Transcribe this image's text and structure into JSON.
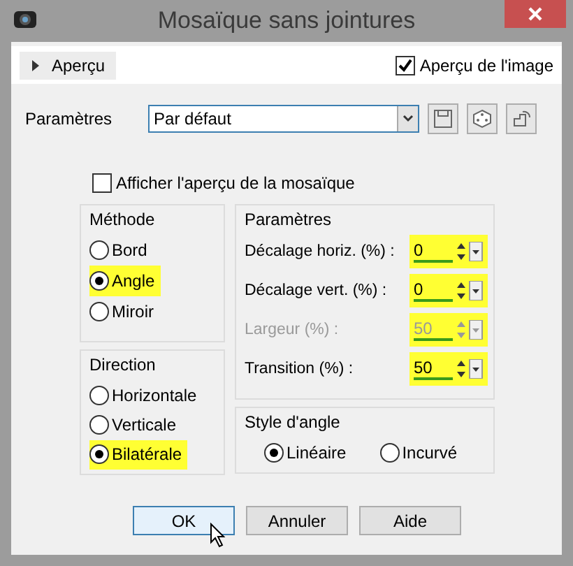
{
  "window": {
    "title": "Mosaïque sans jointures"
  },
  "preview_toggle": {
    "label": "Aperçu",
    "expanded": false
  },
  "image_preview": {
    "label": "Aperçu de l'image",
    "checked": true
  },
  "presets": {
    "label": "Paramètres",
    "value": "Par défaut"
  },
  "show_tile_preview": {
    "label": "Afficher l'aperçu de la mosaïque",
    "checked": false
  },
  "method": {
    "title": "Méthode",
    "options": [
      {
        "label": "Bord",
        "selected": false,
        "highlighted": false
      },
      {
        "label": "Angle",
        "selected": true,
        "highlighted": true
      },
      {
        "label": "Miroir",
        "selected": false,
        "highlighted": false
      }
    ]
  },
  "direction": {
    "title": "Direction",
    "options": [
      {
        "label": "Horizontale",
        "selected": false,
        "highlighted": false
      },
      {
        "label": "Verticale",
        "selected": false,
        "highlighted": false
      },
      {
        "label": "Bilatérale",
        "selected": true,
        "highlighted": true
      }
    ]
  },
  "parameters": {
    "title": "Paramètres",
    "fields": [
      {
        "label": "Décalage horiz. (%) :",
        "value": "0",
        "disabled": false,
        "highlighted": true
      },
      {
        "label": "Décalage vert. (%) :",
        "value": "0",
        "disabled": false,
        "highlighted": true
      },
      {
        "label": "Largeur (%) :",
        "value": "50",
        "disabled": true,
        "highlighted": true
      },
      {
        "label": "Transition (%) :",
        "value": "50",
        "disabled": false,
        "highlighted": true
      }
    ]
  },
  "angle_style": {
    "title": "Style d'angle",
    "options": [
      {
        "label": "Linéaire",
        "selected": true
      },
      {
        "label": "Incurvé",
        "selected": false
      }
    ]
  },
  "buttons": [
    {
      "label": "OK",
      "default": true
    },
    {
      "label": "Annuler",
      "default": false
    },
    {
      "label": "Aide",
      "default": false
    }
  ]
}
